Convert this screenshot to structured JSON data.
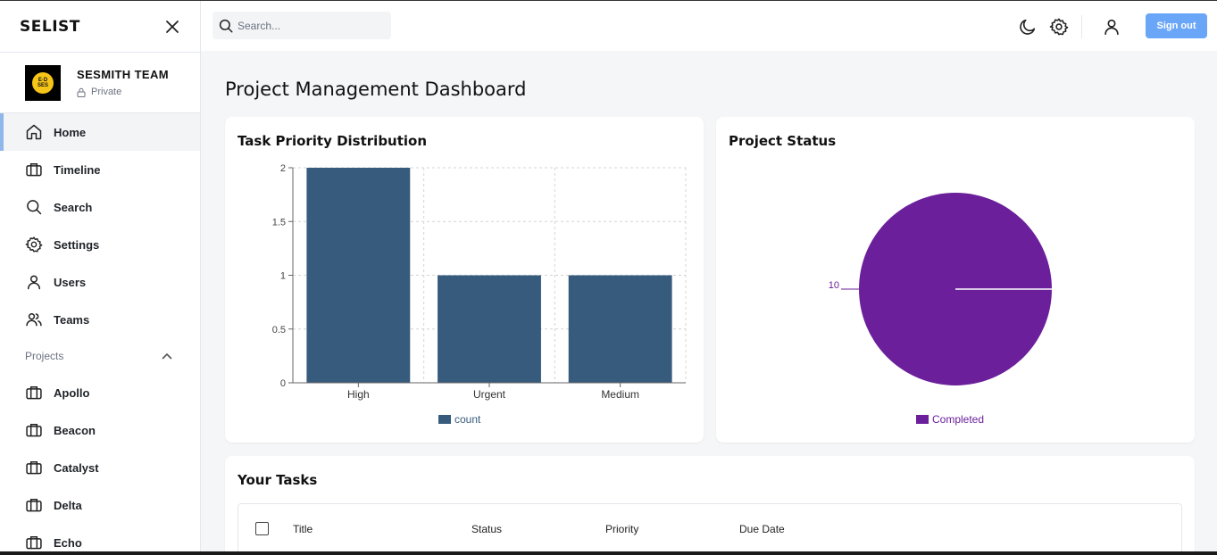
{
  "app": {
    "name": "SELIST"
  },
  "team": {
    "name": "SESMITH TEAM",
    "visibility": "Private",
    "logo_text": "E·D SES"
  },
  "nav": [
    {
      "label": "Home",
      "icon": "home-icon",
      "active": true
    },
    {
      "label": "Timeline",
      "icon": "briefcase-icon"
    },
    {
      "label": "Search",
      "icon": "search-icon"
    },
    {
      "label": "Settings",
      "icon": "gear-icon"
    },
    {
      "label": "Users",
      "icon": "user-icon"
    },
    {
      "label": "Teams",
      "icon": "users-icon"
    }
  ],
  "projects_section": {
    "label": "Projects",
    "expanded": true
  },
  "projects": [
    {
      "label": "Apollo"
    },
    {
      "label": "Beacon"
    },
    {
      "label": "Catalyst"
    },
    {
      "label": "Delta"
    },
    {
      "label": "Echo"
    }
  ],
  "topbar": {
    "search_placeholder": "Search...",
    "sign_out": "Sign out"
  },
  "page_title": "Project Management Dashboard",
  "priority_card": {
    "title": "Task Priority Distribution"
  },
  "status_card": {
    "title": "Project Status"
  },
  "tasks": {
    "title": "Your Tasks",
    "columns": [
      "Title",
      "Status",
      "Priority",
      "Due Date"
    ]
  },
  "colors": {
    "bar": "#375b7d",
    "pie": "#6b1f9a",
    "accent": "#6aa6f8"
  },
  "chart_data": [
    {
      "type": "bar",
      "title": "Task Priority Distribution",
      "categories": [
        "High",
        "Urgent",
        "Medium"
      ],
      "series": [
        {
          "name": "count",
          "values": [
            2,
            1,
            1
          ]
        }
      ],
      "ylim": [
        0,
        2
      ],
      "yticks": [
        "0",
        "0.5",
        "1",
        "1.5",
        "2"
      ],
      "grid": true,
      "legend": "bottom"
    },
    {
      "type": "pie",
      "title": "Project Status",
      "slices": [
        {
          "label": "Completed",
          "value": 10
        }
      ],
      "data_labels": [
        "10"
      ],
      "legend": "bottom"
    }
  ]
}
